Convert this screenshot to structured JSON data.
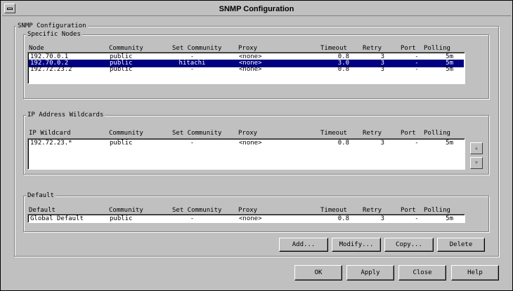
{
  "window": {
    "title": "SNMP Configuration"
  },
  "outer_group_label": "SNMP Configuration",
  "columns": {
    "community": "Community",
    "set_community": "Set Community",
    "proxy": "Proxy",
    "timeout": "Timeout",
    "retry": "Retry",
    "port": "Port",
    "polling": "Polling"
  },
  "specific_nodes": {
    "label": "Specific Nodes",
    "first_col": "Node",
    "rows": [
      {
        "node": "192.70.0.1",
        "community": "public",
        "set_community": "-",
        "proxy": "<none>",
        "timeout": "0.8",
        "retry": "3",
        "port": "-",
        "polling": "5m"
      },
      {
        "node": "192.70.0.2",
        "community": "public",
        "set_community": "hitachi",
        "proxy": "<none>",
        "timeout": "3.0",
        "retry": "3",
        "port": "-",
        "polling": "5m",
        "selected": true
      },
      {
        "node": "192.72.23.2",
        "community": "public",
        "set_community": "-",
        "proxy": "<none>",
        "timeout": "0.8",
        "retry": "3",
        "port": "-",
        "polling": "5m"
      }
    ]
  },
  "ip_wildcards": {
    "label": "IP Address Wildcards",
    "first_col": "IP Wildcard",
    "rows": [
      {
        "node": "192.72.23.*",
        "community": "public",
        "set_community": "-",
        "proxy": "<none>",
        "timeout": "0.8",
        "retry": "3",
        "port": "-",
        "polling": "5m"
      }
    ],
    "scroll_up": "▲",
    "scroll_down": "▼"
  },
  "default_group": {
    "label": "Default",
    "first_col": "Default",
    "rows": [
      {
        "node": "Global Default",
        "community": "public",
        "set_community": "-",
        "proxy": "<none>",
        "timeout": "0.8",
        "retry": "3",
        "port": "-",
        "polling": "5m"
      }
    ]
  },
  "buttons": {
    "add": "Add...",
    "modify": "Modify...",
    "copy": "Copy...",
    "delete": "Delete",
    "ok": "OK",
    "apply": "Apply",
    "close": "Close",
    "help": "Help"
  }
}
